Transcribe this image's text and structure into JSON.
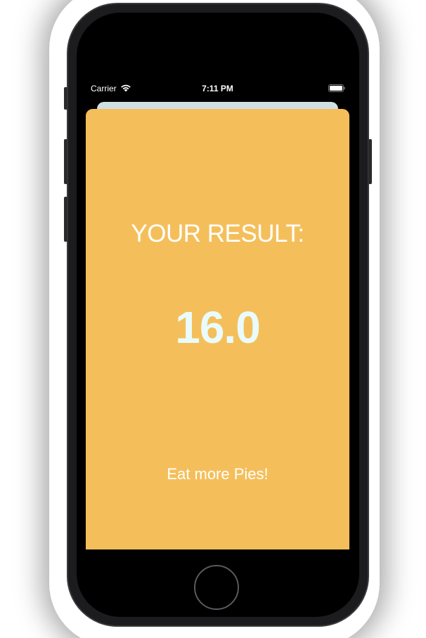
{
  "status_bar": {
    "carrier": "Carrier",
    "time": "7:11 PM",
    "wifi_icon": "wifi-icon",
    "battery_icon": "battery-icon"
  },
  "result": {
    "title": "YOUR RESULT:",
    "value": "16.0",
    "advice": "Eat more Pies!"
  },
  "colors": {
    "background": "#f4bf5b",
    "value_text": "#e9fbfb",
    "text": "#ffffff",
    "back_card": "#cfe0e3"
  }
}
